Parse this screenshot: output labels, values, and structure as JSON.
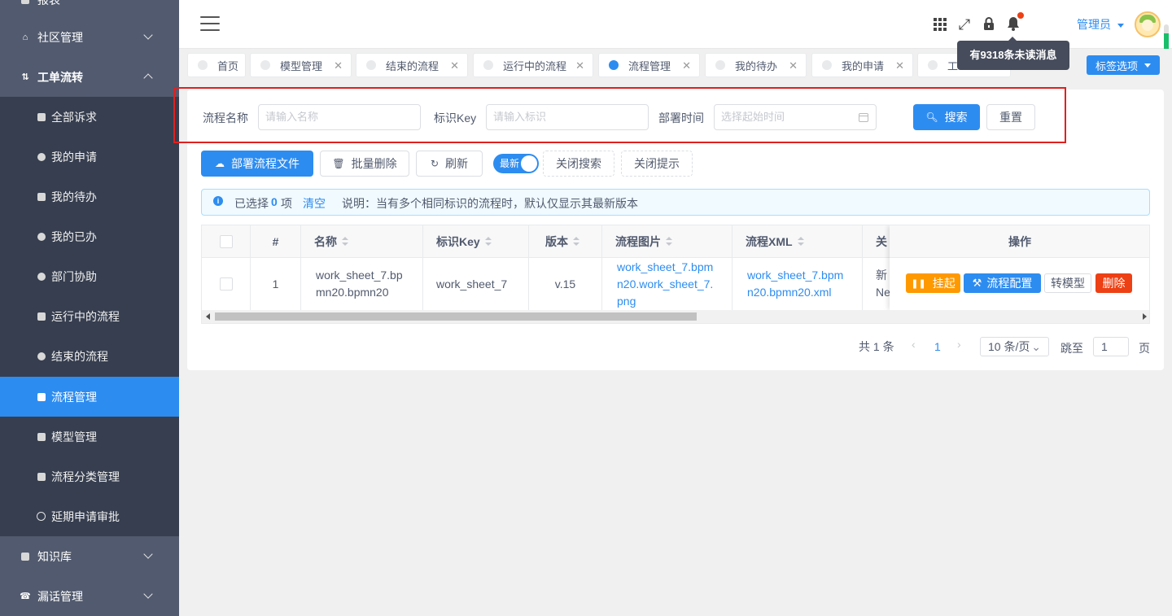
{
  "sidebar": {
    "items": [
      {
        "label": "报表",
        "icon": "chart-icon"
      },
      {
        "label": "社区管理",
        "icon": "home-icon"
      },
      {
        "label": "工单流转",
        "icon": "workflow-icon"
      },
      {
        "label": "知识库",
        "icon": "book-icon"
      },
      {
        "label": "漏话管理",
        "icon": "phone-icon"
      }
    ],
    "sub_items": [
      {
        "label": "全部诉求"
      },
      {
        "label": "我的申请"
      },
      {
        "label": "我的待办"
      },
      {
        "label": "我的已办"
      },
      {
        "label": "部门协助"
      },
      {
        "label": "运行中的流程"
      },
      {
        "label": "结束的流程"
      },
      {
        "label": "流程管理"
      },
      {
        "label": "模型管理"
      },
      {
        "label": "流程分类管理"
      },
      {
        "label": "延期申请审批"
      }
    ]
  },
  "header": {
    "user_name": "管理员",
    "tooltip": "有9318条未读消息"
  },
  "tabs": [
    {
      "label": "首页"
    },
    {
      "label": "模型管理"
    },
    {
      "label": "结束的流程"
    },
    {
      "label": "运行中的流程"
    },
    {
      "label": "流程管理"
    },
    {
      "label": "我的待办"
    },
    {
      "label": "我的申请"
    },
    {
      "label": "工"
    }
  ],
  "tag_options_label": "标签选项",
  "search": {
    "name_label": "流程名称",
    "name_placeholder": "请输入名称",
    "key_label": "标识Key",
    "key_placeholder": "请输入标识",
    "time_label": "部署时间",
    "time_placeholder": "选择起始时间",
    "search_button": "搜索",
    "reset_button": "重置"
  },
  "toolbar": {
    "deploy": "部署流程文件",
    "batch_delete": "批量删除",
    "refresh": "刷新",
    "switch_label": "最新",
    "close_search": "关闭搜索",
    "close_tip": "关闭提示"
  },
  "alert": {
    "selected_prefix": "已选择",
    "selected_count": "0",
    "selected_suffix": "项",
    "clear": "清空",
    "note": "说明：当有多个相同标识的流程时，默认仅显示其最新版本"
  },
  "table": {
    "headers": {
      "index": "#",
      "name": "名称",
      "key": "标识Key",
      "version": "版本",
      "image": "流程图片",
      "xml": "流程XML",
      "extra": "关",
      "actions": "操作"
    },
    "rows": [
      {
        "index": "1",
        "name": "work_sheet_7.bpmn20.bpmn20",
        "key": "work_sheet_7",
        "version": "v.15",
        "image": "work_sheet_7.bpmn20.work_sheet_7.png",
        "xml": "work_sheet_7.bpmn20.bpmn20.xml",
        "extra_1": "新",
        "extra_2": "Ne"
      }
    ],
    "actions": {
      "suspend": "挂起",
      "config": "流程配置",
      "to_model": "转模型",
      "delete": "删除"
    }
  },
  "pagination": {
    "total": "共 1 条",
    "current_page": "1",
    "page_size": "10 条/页",
    "jump_label": "跳至",
    "jump_value": "1",
    "page_suffix": "页"
  },
  "colors": {
    "primary": "#2d8cf0",
    "sidebar": "#515a6e",
    "submenu": "#363e4f",
    "warning": "#ff9900",
    "danger": "#ed4014"
  }
}
